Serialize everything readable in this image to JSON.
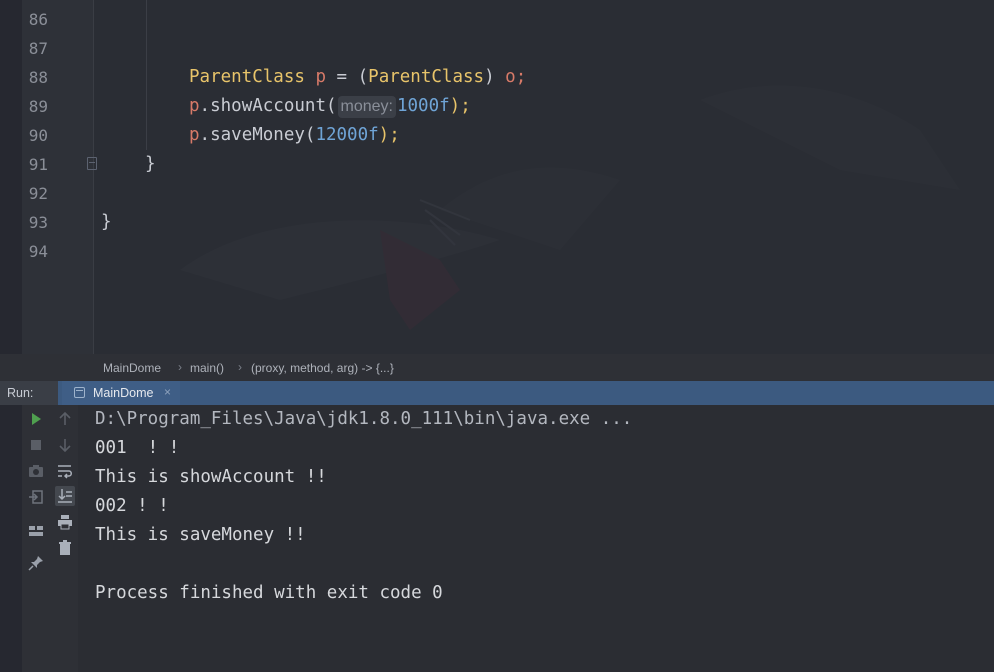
{
  "editor": {
    "line_numbers": [
      "86",
      "87",
      "88",
      "89",
      "90",
      "91",
      "92",
      "93",
      "94"
    ],
    "line88": {
      "type1": "ParentClass",
      "var": "p",
      "eq": " = (",
      "type2": "ParentClass",
      "close": ") ",
      "obj": "o",
      "semi": ";"
    },
    "line89": {
      "var": "p",
      "method": ".showAccount(",
      "hint": "money:",
      "arg": "1000f",
      "end": ");"
    },
    "line90": {
      "var": "p",
      "method": ".saveMoney(",
      "arg": "12000f",
      "end": ");"
    },
    "line91": {
      "brace": "}"
    },
    "line93": {
      "brace": "}"
    }
  },
  "breadcrumbs": [
    "MainDome",
    "main()",
    "(proxy, method, arg) -> {...}"
  ],
  "run_panel": {
    "label": "Run:",
    "tab_name": "MainDome",
    "tab_close": "×",
    "console_lines": [
      "D:\\Program_Files\\Java\\jdk1.8.0_111\\bin\\java.exe ...",
      "001  ! !",
      "This is showAccount !!",
      "002 ! !",
      "This is saveMoney !!",
      "",
      "Process finished with exit code 0"
    ]
  },
  "toolbar_icons": {
    "rerun": "play-icon",
    "stop": "stop-icon",
    "dump": "camera-icon",
    "restore": "restore-layout-icon",
    "layout": "layout-icon",
    "pin": "pin-icon",
    "up": "up-arrow-icon",
    "down": "down-arrow-icon",
    "wrap": "soft-wrap-icon",
    "scroll": "scroll-to-end-icon",
    "print": "print-icon",
    "clear": "trash-icon"
  },
  "colors": {
    "class_name": "#e8c46a",
    "variable": "#d77a68",
    "number": "#6fa4d6",
    "run_bar": "#3c5a80",
    "run_icon": "#4fa04f",
    "background": "#2b2d33"
  }
}
